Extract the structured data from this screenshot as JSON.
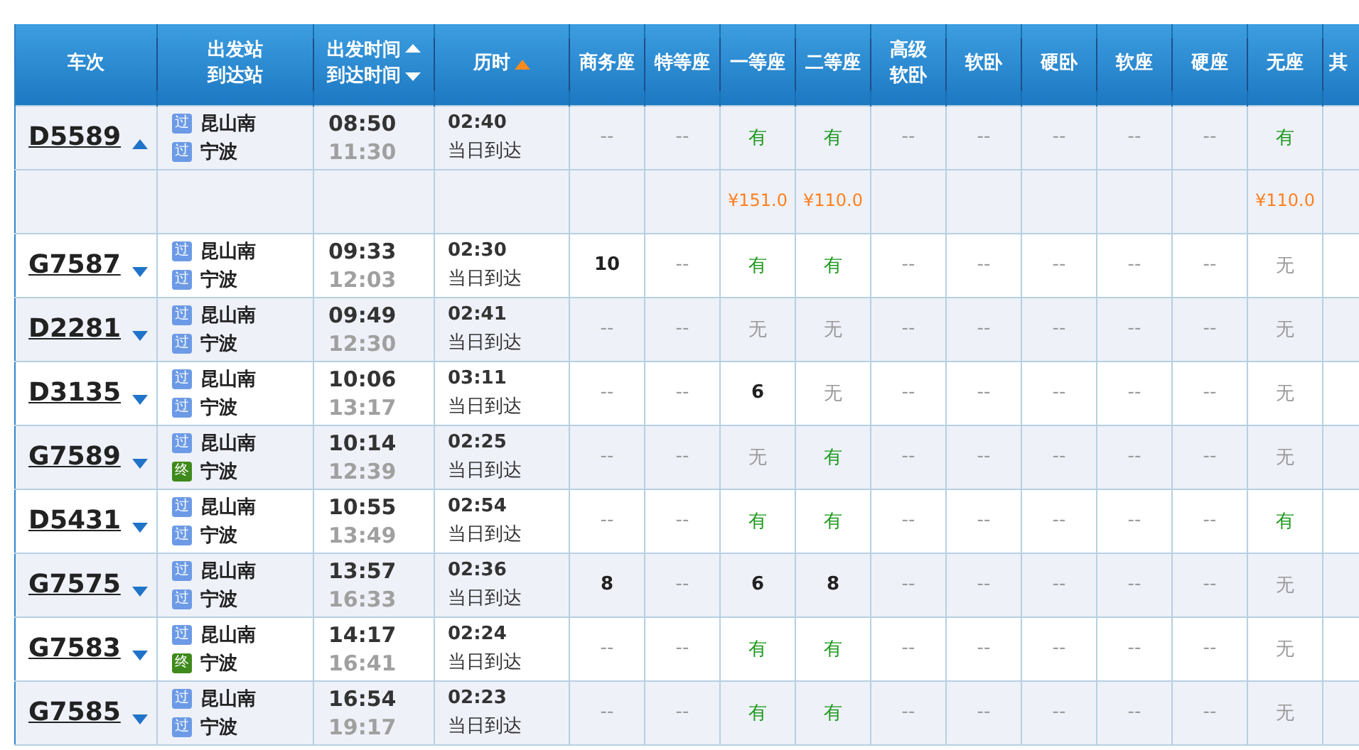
{
  "table": {
    "columns": [
      {
        "lines": [
          "车次"
        ],
        "kind": "plain"
      },
      {
        "lines": [
          "出发站",
          "到达站"
        ],
        "kind": "plain"
      },
      {
        "lines": [
          "出发时间",
          "到达时间"
        ],
        "kind": "pair"
      },
      {
        "lines": [
          "历时"
        ],
        "kind": "sorted"
      },
      {
        "lines": [
          "商务座"
        ],
        "kind": "plain"
      },
      {
        "lines": [
          "特等座"
        ],
        "kind": "plain"
      },
      {
        "lines": [
          "一等座"
        ],
        "kind": "plain"
      },
      {
        "lines": [
          "二等座"
        ],
        "kind": "plain"
      },
      {
        "lines": [
          "高级",
          "软卧"
        ],
        "kind": "plain"
      },
      {
        "lines": [
          "软卧"
        ],
        "kind": "plain"
      },
      {
        "lines": [
          "硬卧"
        ],
        "kind": "plain"
      },
      {
        "lines": [
          "软座"
        ],
        "kind": "plain"
      },
      {
        "lines": [
          "硬座"
        ],
        "kind": "plain"
      },
      {
        "lines": [
          "无座"
        ],
        "kind": "plain"
      },
      {
        "lines": [
          "其"
        ],
        "kind": "plain"
      }
    ],
    "rows": [
      {
        "train": "D5589",
        "expanded": true,
        "from": {
          "badge": "过",
          "kind": "pass",
          "name": "昆山南"
        },
        "to": {
          "badge": "过",
          "kind": "pass",
          "name": "宁波"
        },
        "depart": "08:50",
        "arrive": "11:30",
        "duration": "02:40",
        "arrival_note": "当日到达",
        "seats": [
          {
            "kind": "na",
            "text": "--"
          },
          {
            "kind": "na",
            "text": "--"
          },
          {
            "kind": "yes",
            "text": "有",
            "price": "¥151.0"
          },
          {
            "kind": "yes",
            "text": "有",
            "price": "¥110.0"
          },
          {
            "kind": "na",
            "text": "--"
          },
          {
            "kind": "na",
            "text": "--"
          },
          {
            "kind": "na",
            "text": "--"
          },
          {
            "kind": "na",
            "text": "--"
          },
          {
            "kind": "na",
            "text": "--"
          },
          {
            "kind": "yes",
            "text": "有",
            "price": "¥110.0"
          }
        ]
      },
      {
        "train": "G7587",
        "expanded": false,
        "from": {
          "badge": "过",
          "kind": "pass",
          "name": "昆山南"
        },
        "to": {
          "badge": "过",
          "kind": "pass",
          "name": "宁波"
        },
        "depart": "09:33",
        "arrive": "12:03",
        "duration": "02:30",
        "arrival_note": "当日到达",
        "seats": [
          {
            "kind": "count",
            "text": "10"
          },
          {
            "kind": "na",
            "text": "--"
          },
          {
            "kind": "yes",
            "text": "有"
          },
          {
            "kind": "yes",
            "text": "有"
          },
          {
            "kind": "na",
            "text": "--"
          },
          {
            "kind": "na",
            "text": "--"
          },
          {
            "kind": "na",
            "text": "--"
          },
          {
            "kind": "na",
            "text": "--"
          },
          {
            "kind": "na",
            "text": "--"
          },
          {
            "kind": "no",
            "text": "无"
          }
        ]
      },
      {
        "train": "D2281",
        "expanded": false,
        "from": {
          "badge": "过",
          "kind": "pass",
          "name": "昆山南"
        },
        "to": {
          "badge": "过",
          "kind": "pass",
          "name": "宁波"
        },
        "depart": "09:49",
        "arrive": "12:30",
        "duration": "02:41",
        "arrival_note": "当日到达",
        "seats": [
          {
            "kind": "na",
            "text": "--"
          },
          {
            "kind": "na",
            "text": "--"
          },
          {
            "kind": "no",
            "text": "无"
          },
          {
            "kind": "no",
            "text": "无"
          },
          {
            "kind": "na",
            "text": "--"
          },
          {
            "kind": "na",
            "text": "--"
          },
          {
            "kind": "na",
            "text": "--"
          },
          {
            "kind": "na",
            "text": "--"
          },
          {
            "kind": "na",
            "text": "--"
          },
          {
            "kind": "no",
            "text": "无"
          }
        ]
      },
      {
        "train": "D3135",
        "expanded": false,
        "from": {
          "badge": "过",
          "kind": "pass",
          "name": "昆山南"
        },
        "to": {
          "badge": "过",
          "kind": "pass",
          "name": "宁波"
        },
        "depart": "10:06",
        "arrive": "13:17",
        "duration": "03:11",
        "arrival_note": "当日到达",
        "seats": [
          {
            "kind": "na",
            "text": "--"
          },
          {
            "kind": "na",
            "text": "--"
          },
          {
            "kind": "count",
            "text": "6"
          },
          {
            "kind": "no",
            "text": "无"
          },
          {
            "kind": "na",
            "text": "--"
          },
          {
            "kind": "na",
            "text": "--"
          },
          {
            "kind": "na",
            "text": "--"
          },
          {
            "kind": "na",
            "text": "--"
          },
          {
            "kind": "na",
            "text": "--"
          },
          {
            "kind": "no",
            "text": "无"
          }
        ]
      },
      {
        "train": "G7589",
        "expanded": false,
        "from": {
          "badge": "过",
          "kind": "pass",
          "name": "昆山南"
        },
        "to": {
          "badge": "终",
          "kind": "terminal",
          "name": "宁波"
        },
        "depart": "10:14",
        "arrive": "12:39",
        "duration": "02:25",
        "arrival_note": "当日到达",
        "seats": [
          {
            "kind": "na",
            "text": "--"
          },
          {
            "kind": "na",
            "text": "--"
          },
          {
            "kind": "no",
            "text": "无"
          },
          {
            "kind": "yes",
            "text": "有"
          },
          {
            "kind": "na",
            "text": "--"
          },
          {
            "kind": "na",
            "text": "--"
          },
          {
            "kind": "na",
            "text": "--"
          },
          {
            "kind": "na",
            "text": "--"
          },
          {
            "kind": "na",
            "text": "--"
          },
          {
            "kind": "no",
            "text": "无"
          }
        ]
      },
      {
        "train": "D5431",
        "expanded": false,
        "from": {
          "badge": "过",
          "kind": "pass",
          "name": "昆山南"
        },
        "to": {
          "badge": "过",
          "kind": "pass",
          "name": "宁波"
        },
        "depart": "10:55",
        "arrive": "13:49",
        "duration": "02:54",
        "arrival_note": "当日到达",
        "seats": [
          {
            "kind": "na",
            "text": "--"
          },
          {
            "kind": "na",
            "text": "--"
          },
          {
            "kind": "yes",
            "text": "有"
          },
          {
            "kind": "yes",
            "text": "有"
          },
          {
            "kind": "na",
            "text": "--"
          },
          {
            "kind": "na",
            "text": "--"
          },
          {
            "kind": "na",
            "text": "--"
          },
          {
            "kind": "na",
            "text": "--"
          },
          {
            "kind": "na",
            "text": "--"
          },
          {
            "kind": "yes",
            "text": "有"
          }
        ]
      },
      {
        "train": "G7575",
        "expanded": false,
        "from": {
          "badge": "过",
          "kind": "pass",
          "name": "昆山南"
        },
        "to": {
          "badge": "过",
          "kind": "pass",
          "name": "宁波"
        },
        "depart": "13:57",
        "arrive": "16:33",
        "duration": "02:36",
        "arrival_note": "当日到达",
        "seats": [
          {
            "kind": "count",
            "text": "8"
          },
          {
            "kind": "na",
            "text": "--"
          },
          {
            "kind": "count",
            "text": "6"
          },
          {
            "kind": "count",
            "text": "8"
          },
          {
            "kind": "na",
            "text": "--"
          },
          {
            "kind": "na",
            "text": "--"
          },
          {
            "kind": "na",
            "text": "--"
          },
          {
            "kind": "na",
            "text": "--"
          },
          {
            "kind": "na",
            "text": "--"
          },
          {
            "kind": "no",
            "text": "无"
          }
        ]
      },
      {
        "train": "G7583",
        "expanded": false,
        "from": {
          "badge": "过",
          "kind": "pass",
          "name": "昆山南"
        },
        "to": {
          "badge": "终",
          "kind": "terminal",
          "name": "宁波"
        },
        "depart": "14:17",
        "arrive": "16:41",
        "duration": "02:24",
        "arrival_note": "当日到达",
        "seats": [
          {
            "kind": "na",
            "text": "--"
          },
          {
            "kind": "na",
            "text": "--"
          },
          {
            "kind": "yes",
            "text": "有"
          },
          {
            "kind": "yes",
            "text": "有"
          },
          {
            "kind": "na",
            "text": "--"
          },
          {
            "kind": "na",
            "text": "--"
          },
          {
            "kind": "na",
            "text": "--"
          },
          {
            "kind": "na",
            "text": "--"
          },
          {
            "kind": "na",
            "text": "--"
          },
          {
            "kind": "no",
            "text": "无"
          }
        ]
      },
      {
        "train": "G7585",
        "expanded": false,
        "from": {
          "badge": "过",
          "kind": "pass",
          "name": "昆山南"
        },
        "to": {
          "badge": "过",
          "kind": "pass",
          "name": "宁波"
        },
        "depart": "16:54",
        "arrive": "19:17",
        "duration": "02:23",
        "arrival_note": "当日到达",
        "seats": [
          {
            "kind": "na",
            "text": "--"
          },
          {
            "kind": "na",
            "text": "--"
          },
          {
            "kind": "yes",
            "text": "有"
          },
          {
            "kind": "yes",
            "text": "有"
          },
          {
            "kind": "na",
            "text": "--"
          },
          {
            "kind": "na",
            "text": "--"
          },
          {
            "kind": "na",
            "text": "--"
          },
          {
            "kind": "na",
            "text": "--"
          },
          {
            "kind": "na",
            "text": "--"
          },
          {
            "kind": "no",
            "text": "无"
          }
        ]
      }
    ]
  }
}
